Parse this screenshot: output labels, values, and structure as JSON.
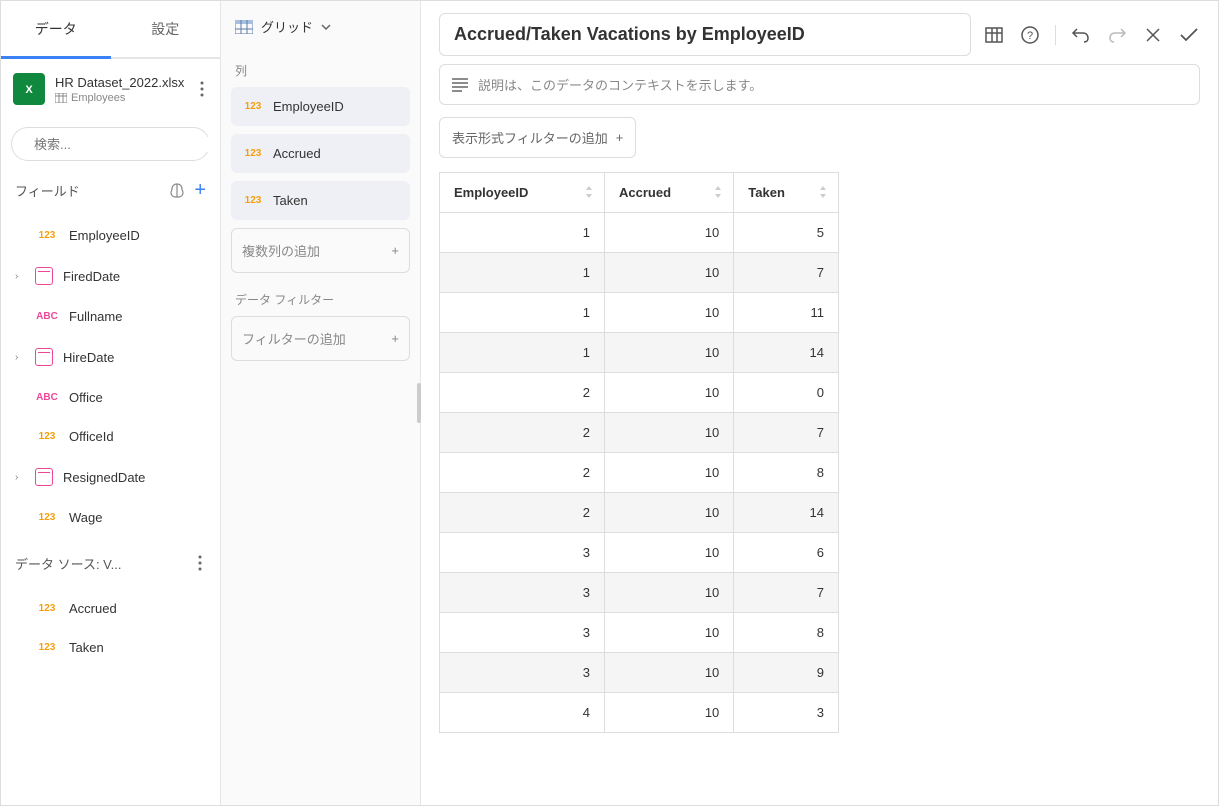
{
  "tabs": {
    "data": "データ",
    "settings": "設定"
  },
  "datasource": {
    "filename": "HR Dataset_2022.xlsx",
    "table": "Employees"
  },
  "search": {
    "placeholder": "検索..."
  },
  "fields_section": {
    "label": "フィールド"
  },
  "fields": [
    {
      "type": "123",
      "name": "EmployeeID",
      "expandable": false
    },
    {
      "type": "date",
      "name": "FiredDate",
      "expandable": true
    },
    {
      "type": "abc",
      "name": "Fullname",
      "expandable": false
    },
    {
      "type": "date",
      "name": "HireDate",
      "expandable": true
    },
    {
      "type": "abc",
      "name": "Office",
      "expandable": false
    },
    {
      "type": "123",
      "name": "OfficeId",
      "expandable": false
    },
    {
      "type": "date",
      "name": "ResignedDate",
      "expandable": true
    },
    {
      "type": "123",
      "name": "Wage",
      "expandable": false
    }
  ],
  "datasource_section": {
    "label": "データ ソース: V..."
  },
  "ds_fields": [
    {
      "type": "123",
      "name": "Accrued"
    },
    {
      "type": "123",
      "name": "Taken"
    }
  ],
  "viz": {
    "type_label": "グリッド"
  },
  "columns_section": {
    "label": "列"
  },
  "columns": [
    {
      "type": "123",
      "name": "EmployeeID"
    },
    {
      "type": "123",
      "name": "Accrued"
    },
    {
      "type": "123",
      "name": "Taken"
    }
  ],
  "add_columns": "複数列の追加",
  "data_filter_section": "データ フィルター",
  "add_filter": "フィルターの追加",
  "title": "Accrued/Taken Vacations by EmployeeID",
  "desc_placeholder": "説明は、このデータのコンテキストを示します。",
  "viz_filter_btn": "表示形式フィルターの追加",
  "table": {
    "headers": [
      "EmployeeID",
      "Accrued",
      "Taken"
    ],
    "rows": [
      [
        1,
        10,
        5
      ],
      [
        1,
        10,
        7
      ],
      [
        1,
        10,
        11
      ],
      [
        1,
        10,
        14
      ],
      [
        2,
        10,
        0
      ],
      [
        2,
        10,
        7
      ],
      [
        2,
        10,
        8
      ],
      [
        2,
        10,
        14
      ],
      [
        3,
        10,
        6
      ],
      [
        3,
        10,
        7
      ],
      [
        3,
        10,
        8
      ],
      [
        3,
        10,
        9
      ],
      [
        4,
        10,
        3
      ]
    ]
  }
}
